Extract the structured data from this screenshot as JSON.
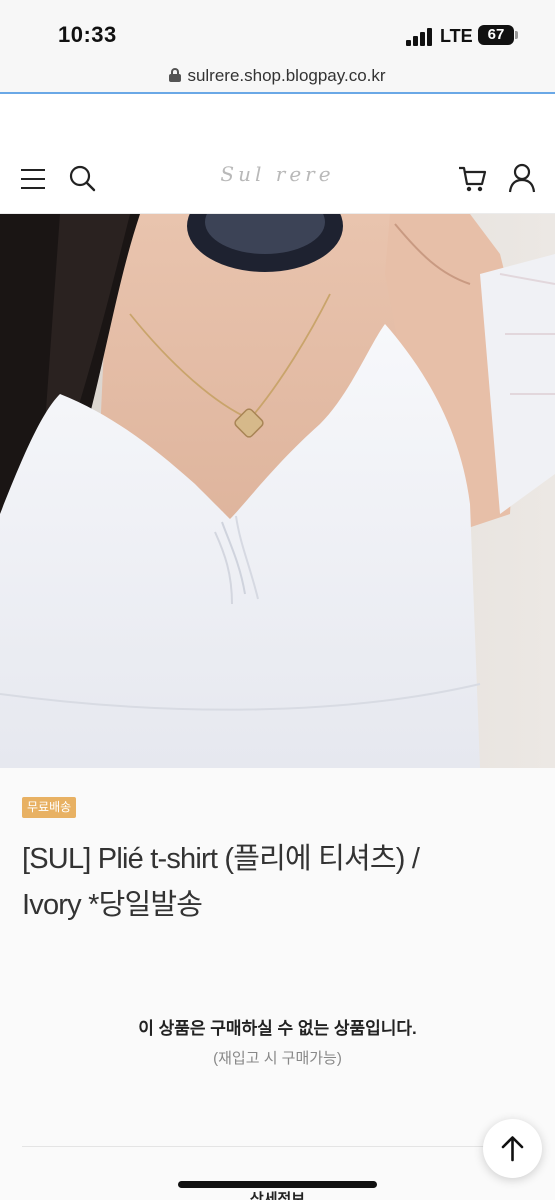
{
  "status_bar": {
    "time": "10:33",
    "network": "LTE",
    "battery": "67"
  },
  "browser": {
    "url": "sulrere.shop.blogpay.co.kr"
  },
  "header": {
    "logo_text": "Sul rere",
    "icons": [
      "menu-icon",
      "search-icon",
      "cart-icon",
      "user-icon"
    ]
  },
  "product": {
    "badge": "무료배송",
    "title_line1": "[SUL] Plié t-shirt (플리에 티셔츠) /",
    "title_line2": "Ivory *당일발송",
    "notice_main": "이 상품은 구매하실 수 없는 상품입니다.",
    "notice_sub": "(재입고 시 구매가능)",
    "detail_tab": "상세정보"
  },
  "colors": {
    "badge": "#e8b163",
    "url_underline": "#6aa8e6"
  }
}
